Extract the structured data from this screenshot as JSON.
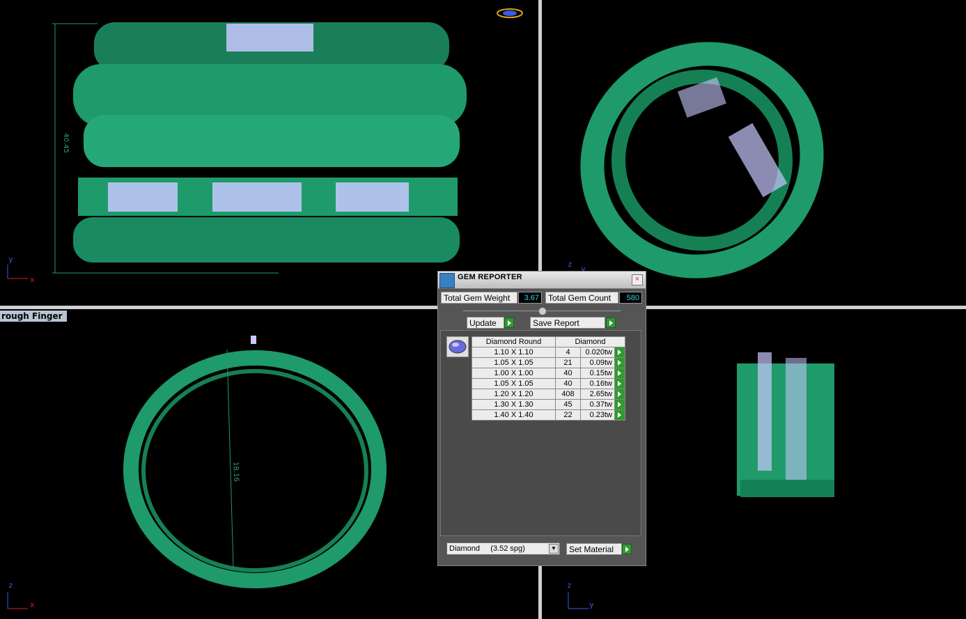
{
  "viewports": {
    "top_left": {
      "axes": {
        "vertical": "y",
        "horizontal": "x"
      },
      "dimension": "40.45"
    },
    "top_right": {
      "axes": {
        "vertical": "z",
        "horizontal": "y"
      }
    },
    "bottom_left": {
      "name": "rough Finger",
      "axes": {
        "vertical": "z",
        "horizontal": "x"
      },
      "dimension": "18.16"
    },
    "bottom_right": {
      "axes": {
        "vertical": "z",
        "horizontal": "y"
      }
    }
  },
  "colors": {
    "model_green": "#1f9a6a",
    "gem_lilac": "#c8c8ff",
    "axis_vertical": "#3b5bdb",
    "axis_horizontal": "#d22020",
    "value_cyan": "#36d0e8"
  },
  "gem_reporter": {
    "title": "GEM REPORTER",
    "close_icon": "×",
    "total_weight_label": "Total Gem Weight",
    "total_weight_value": "3.67",
    "total_count_label": "Total Gem Count",
    "total_count_value": "580",
    "update_label": "Update",
    "save_report_label": "Save Report",
    "table": {
      "header_shape": "Diamond Round",
      "header_material": "Diamond",
      "rows": [
        {
          "size": "1.10 X 1.10",
          "count": "4",
          "weight": "0.020tw"
        },
        {
          "size": "1.05 X 1.05",
          "count": "21",
          "weight": "0.09tw"
        },
        {
          "size": "1.00 X 1.00",
          "count": "40",
          "weight": "0.15tw"
        },
        {
          "size": "1.05 X 1.05",
          "count": "40",
          "weight": "0.16tw"
        },
        {
          "size": "1.20 X 1.20",
          "count": "408",
          "weight": "2.65tw"
        },
        {
          "size": "1.30 X 1.30",
          "count": "45",
          "weight": "0.37tw"
        },
        {
          "size": "1.40 X 1.40",
          "count": "22",
          "weight": "0.23tw"
        }
      ]
    },
    "material_select_value": "Diamond     (3.52 spg)",
    "set_material_label": "Set Material"
  }
}
